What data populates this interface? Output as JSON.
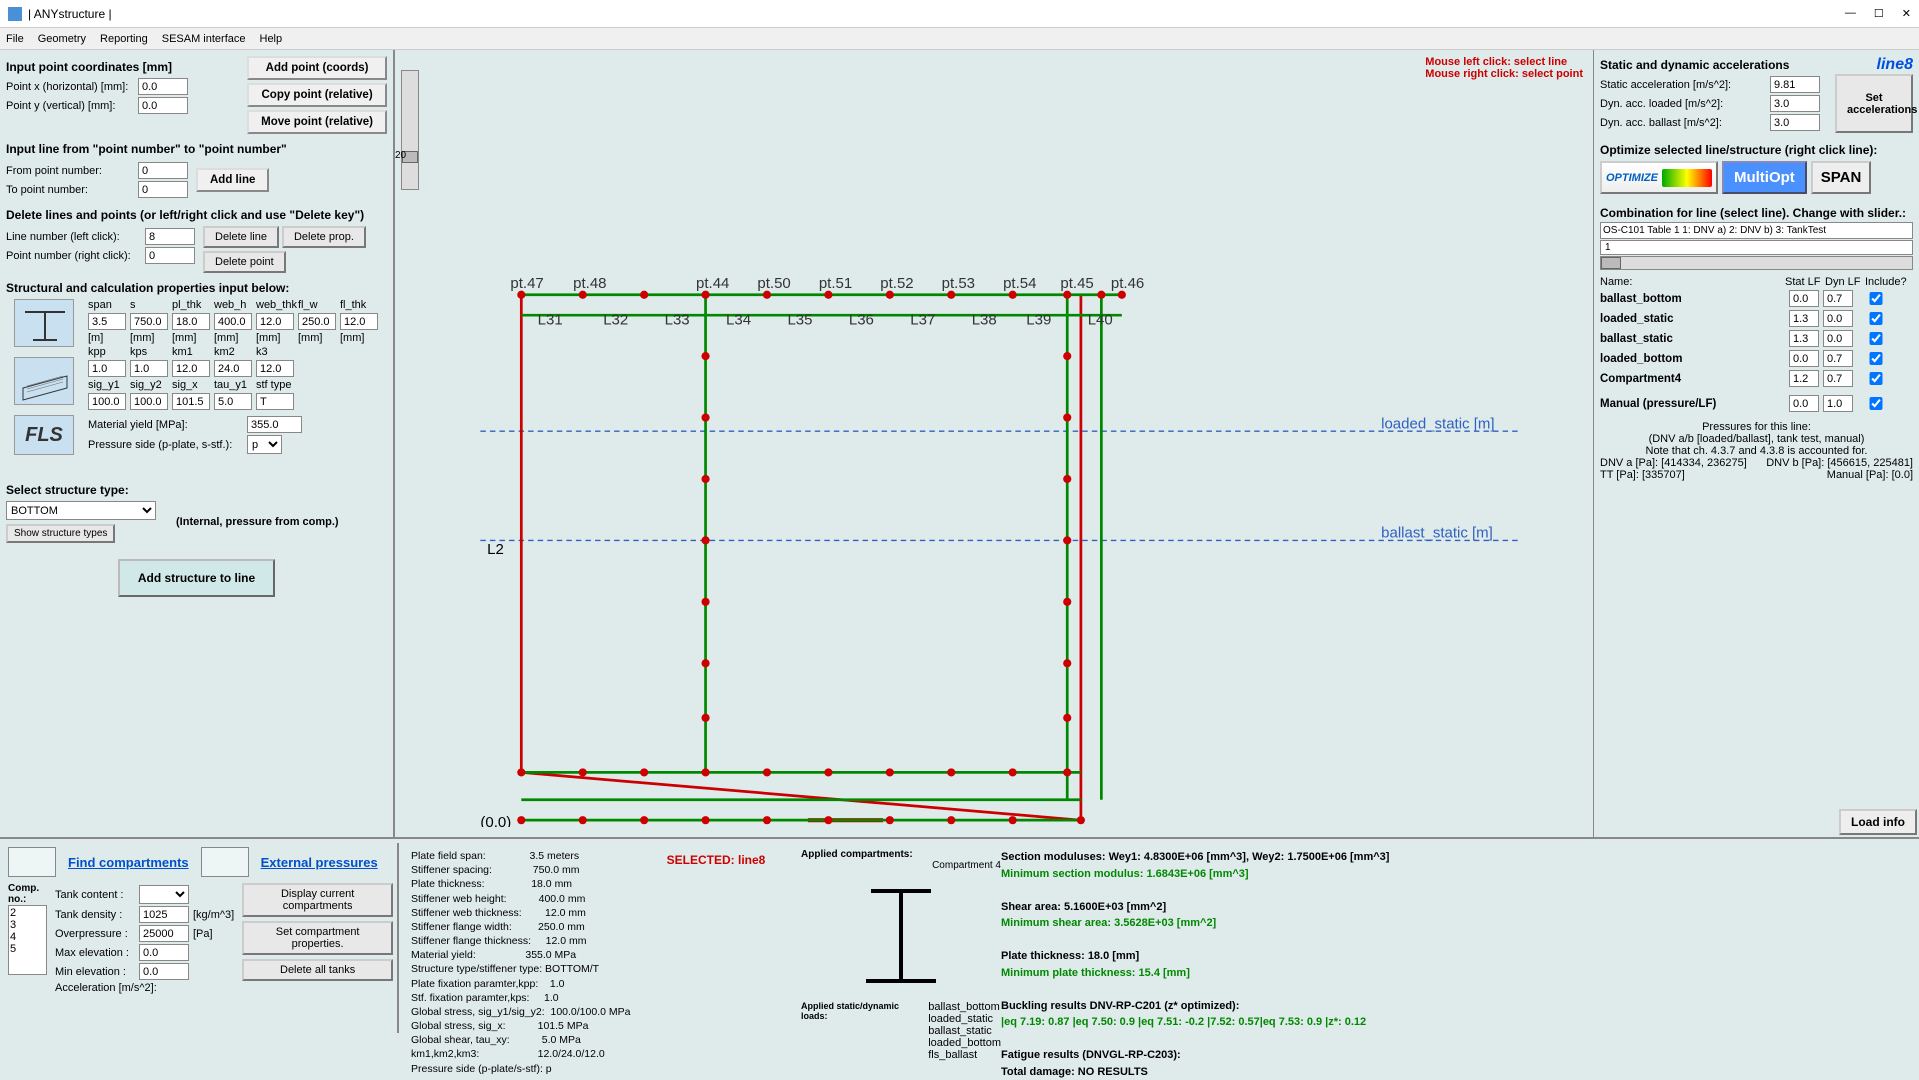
{
  "window": {
    "title": "| ANYstructure |"
  },
  "menu": [
    "File",
    "Geometry",
    "Reporting",
    "SESAM interface",
    "Help"
  ],
  "left": {
    "coords_title": "Input point coordinates [mm]",
    "px_label": "Point x (horizontal) [mm]:",
    "py_label": "Point y (vertical)   [mm]:",
    "px": "0.0",
    "py": "0.0",
    "btn_addpoint": "Add point (coords)",
    "btn_copypoint": "Copy point (relative)",
    "btn_movepoint": "Move point (relative)",
    "line_title": "Input line from \"point number\" to \"point number\"",
    "from_label": "From point number:",
    "to_label": "To point number:",
    "from": "0",
    "to": "0",
    "btn_addline": "Add line",
    "delete_title": "Delete lines and points (or left/right click and use \"Delete key\")",
    "line_num_label": "Line number (left click):",
    "point_num_label": "Point number (right click):",
    "line_num": "8",
    "point_num": "0",
    "btn_delline": "Delete line",
    "btn_delprop": "Delete prop.",
    "btn_delpoint": "Delete point",
    "struct_title": "Structural and calculation properties input below:",
    "hdr1": [
      "span",
      "s",
      "pl_thk",
      "web_h",
      "web_thk",
      "fl_w",
      "fl_thk"
    ],
    "vals1": [
      "3.5",
      "750.0",
      "18.0",
      "400.0",
      "12.0",
      "250.0",
      "12.0"
    ],
    "units1": [
      "[m]",
      "[mm]",
      "[mm]",
      "[mm]",
      "[mm]",
      "[mm]",
      "[mm]"
    ],
    "hdr2": [
      "kpp",
      "kps",
      "km1",
      "km2",
      "k3"
    ],
    "vals2": [
      "1.0",
      "1.0",
      "12.0",
      "24.0",
      "12.0"
    ],
    "hdr3": [
      "sig_y1",
      "sig_y2",
      "sig_x",
      "tau_y1",
      "stf type"
    ],
    "vals3": [
      "100.0",
      "100.0",
      "101.5",
      "5.0",
      "T"
    ],
    "yield_label": "Material yield [MPa]:",
    "yield": "355.0",
    "pside_label": "Pressure side (p-plate, s-stf.):",
    "pside": "p",
    "selstruct_label": "Select structure type:",
    "struct_type": "BOTTOM",
    "btn_showtypes": "Show structure types",
    "internal_note": "(Internal, pressure from comp.)",
    "btn_addstruct": "Add structure to line"
  },
  "canvas": {
    "hint1": "Mouse left click:  select line",
    "hint2": "Mouse right click: select point",
    "loaded_static": "loaded_static [m]",
    "ballast_static": "ballast_static [m]",
    "origin": "(0,0)",
    "scale_label": "20",
    "l2": "L2",
    "selected_line": "Line 8"
  },
  "right": {
    "accel_title": "Static and dynamic accelerations",
    "line_label": "line8",
    "sa_label": "Static acceleration [m/s^2]:",
    "sa": "9.81",
    "dl_label": "Dyn. acc. loaded [m/s^2]:",
    "dl": "3.0",
    "db_label": "Dyn. acc. ballast [m/s^2]:",
    "db": "3.0",
    "btn_setacc": "Set accelerations",
    "opt_title": "Optimize selected line/structure (right click line):",
    "btn_opt": "OPTIMIZE",
    "btn_multi": "MultiOpt",
    "btn_span": "SPAN",
    "combo_title": "Combination for line (select line). Change with slider.:",
    "combo_help": "OS-C101 Table 1    1: DNV a)    2: DNV b)    3: TankTest",
    "combo_val": "1",
    "hdr_name": "Name:",
    "hdr_stat": "Stat LF",
    "hdr_dyn": "Dyn LF",
    "hdr_inc": "Include?",
    "combos": [
      {
        "name": "ballast_bottom",
        "stat": "0.0",
        "dyn": "0.7"
      },
      {
        "name": "loaded_static",
        "stat": "1.3",
        "dyn": "0.0"
      },
      {
        "name": "ballast_static",
        "stat": "1.3",
        "dyn": "0.0"
      },
      {
        "name": "loaded_bottom",
        "stat": "0.0",
        "dyn": "0.7"
      },
      {
        "name": "Compartment4",
        "stat": "1.2",
        "dyn": "0.7"
      }
    ],
    "manual_label": "Manual (pressure/LF)",
    "manual_p": "0.0",
    "manual_lf": "1.0",
    "press_title": "Pressures for this line:",
    "press_l1": "(DNV a/b [loaded/ballast], tank test, manual)",
    "press_l2": "Note that ch. 4.3.7 and 4.3.8 is accounted for.",
    "press_l3a": "DNV a [Pa]: [414334, 236275]",
    "press_l3b": "DNV b [Pa]: [456615, 225481]",
    "press_l4a": "TT [Pa]: [335707]",
    "press_l4b": "Manual [Pa]: [0.0]",
    "btn_loadinfo": "Load info"
  },
  "bottom": {
    "find_comp": "Find compartments",
    "ext_press": "External pressures",
    "comp_no": "Comp. no.:",
    "comp_list": [
      "2",
      "3",
      "4",
      "5"
    ],
    "tank_content": "Tank content :",
    "tank_density": "Tank density :",
    "density": "1025",
    "density_u": "[kg/m^3]",
    "overpressure": "Overpressure :",
    "op": "25000",
    "op_u": "[Pa]",
    "max_elev": "Max elevation :",
    "max_e": "0.0",
    "min_elev": "Min elevation :",
    "min_e": "0.0",
    "accel": "Acceleration [m/s^2]:",
    "btn_display": "Display current compartments",
    "btn_setcomp": "Set compartment properties.",
    "btn_deltanks": "Delete all tanks",
    "details": [
      "Plate field span:               3.5 meters",
      "Stiffener spacing:              750.0 mm",
      "Plate thickness:                18.0 mm",
      "Stiffener web height:           400.0 mm",
      "Stiffener web thickness:        12.0 mm",
      "Stiffener flange width:         250.0 mm",
      "Stiffener flange thickness:     12.0 mm",
      "Material yield:                 355.0 MPa",
      "Structure type/stiffener type: BOTTOM/T",
      "Plate fixation paramter,kpp:    1.0",
      "Stf. fixation paramter,kps:     1.0",
      "Global stress, sig_y1/sig_y2:  100.0/100.0 MPa",
      "Global stress, sig_x:           101.5 MPa",
      "Global shear, tau_xy:           5.0 MPa",
      "km1,km2,km3:                    12.0/24.0/12.0",
      "Pressure side (p-plate/s-stf): p"
    ],
    "selected": "SELECTED: line8",
    "applied_comp_label": "Applied compartments:",
    "applied_comp": "Compartment 4",
    "applied_loads_label": "Applied static/dynamic loads:",
    "applied_loads": [
      "ballast_bottom",
      "loaded_static",
      "ballast_static",
      "loaded_bottom",
      "fls_ballast"
    ],
    "results": [
      {
        "t": "Section moduluses: Wey1: 4.8300E+06 [mm^3],  Wey2: 1.7500E+06 [mm^3]",
        "c": "black"
      },
      {
        "t": "Minimum section modulus: 1.6843E+06 [mm^3]",
        "c": "green"
      },
      {
        "t": "",
        "c": ""
      },
      {
        "t": "Shear area: 5.1600E+03 [mm^2]",
        "c": "black"
      },
      {
        "t": "Minimum shear area: 3.5628E+03 [mm^2]",
        "c": "green"
      },
      {
        "t": "",
        "c": ""
      },
      {
        "t": "Plate thickness: 18.0 [mm]",
        "c": "black"
      },
      {
        "t": "Minimum plate thickness: 15.4 [mm]",
        "c": "green"
      },
      {
        "t": "",
        "c": ""
      },
      {
        "t": "Buckling results DNV-RP-C201 (z* optimized):",
        "c": "black"
      },
      {
        "t": "|eq 7.19: 0.87 |eq 7.50: 0.9 |eq 7.51: -0.2 |7.52: 0.57|eq 7.53: 0.9 |z*: 0.12",
        "c": "green"
      },
      {
        "t": "",
        "c": ""
      },
      {
        "t": "Fatigue results (DNVGL-RP-C203):",
        "c": "black"
      },
      {
        "t": "Total damage: NO RESULTS",
        "c": "black"
      }
    ]
  }
}
